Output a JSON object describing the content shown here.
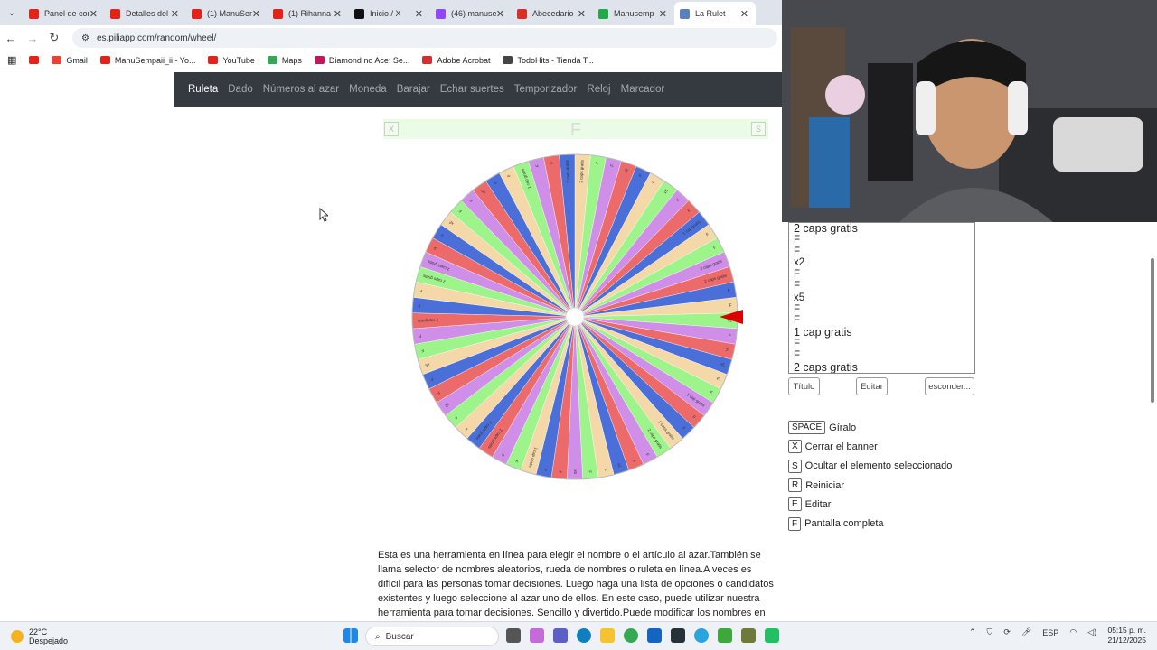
{
  "browser": {
    "tabs": [
      {
        "label": "Panel de con",
        "color": "#e62117"
      },
      {
        "label": "Detalles del",
        "color": "#e62117"
      },
      {
        "label": "(1) ManuSem",
        "color": "#e62117"
      },
      {
        "label": "(1) Rihanna",
        "color": "#e62117"
      },
      {
        "label": "Inicio / X",
        "color": "#111111"
      },
      {
        "label": "(46) manuse",
        "color": "#9146ff"
      },
      {
        "label": "Abecedario",
        "color": "#d93025"
      },
      {
        "label": "Manusemp",
        "color": "#22a84a"
      },
      {
        "label": "La Rulet",
        "color": "#5b7fbf"
      }
    ],
    "url": "es.piliapp.com/random/wheel/",
    "bookmarks": [
      {
        "label": "",
        "color": "#e62117"
      },
      {
        "label": "Gmail",
        "color": "#ea4335"
      },
      {
        "label": "ManuSempaii_ii - Yo...",
        "color": "#e62117"
      },
      {
        "label": "YouTube",
        "color": "#e62117"
      },
      {
        "label": "Maps",
        "color": "#34a853"
      },
      {
        "label": "Diamond no Ace: Se...",
        "color": "#c2185b"
      },
      {
        "label": "Adobe Acrobat",
        "color": "#d32f2f"
      },
      {
        "label": "TodoHits - Tienda T...",
        "color": "#444444"
      }
    ]
  },
  "site": {
    "nav": [
      "Ruleta",
      "Dado",
      "Números al azar",
      "Moneda",
      "Barajar",
      "Echar suertes",
      "Temporizador",
      "Reloj",
      "Marcador"
    ],
    "banner": {
      "close_key": "X",
      "title": "F",
      "save_key": "S"
    }
  },
  "wheel": {
    "colors": [
      "#f4d8a8",
      "#9df48a",
      "#cf8ee8",
      "#ec6a6a",
      "#4a6fd9"
    ],
    "labels": [
      "2 caps gratis",
      "F",
      "F",
      "x2",
      "F",
      "F",
      "x5",
      "F",
      "F",
      "1 cap gratis",
      "F",
      "F",
      "2 caps gratis"
    ],
    "pointer_color": "#dd0000"
  },
  "entries": [
    "2 caps gratis",
    "F",
    "F",
    "x2",
    "F",
    "F",
    "x5",
    "F",
    "F",
    "1 cap gratis",
    "F",
    "F",
    "2 caps gratis"
  ],
  "controls": {
    "title_btn": "Título",
    "edit_btn": "Editar",
    "hide_btn": "esconder..."
  },
  "shortcuts": [
    {
      "key": "SPACE",
      "label": "Gíralo"
    },
    {
      "key": "X",
      "label": "Cerrar el banner"
    },
    {
      "key": "S",
      "label": "Ocultar el elemento seleccionado"
    },
    {
      "key": "R",
      "label": "Reiniciar"
    },
    {
      "key": "E",
      "label": "Editar"
    },
    {
      "key": "F",
      "label": "Pantalla completa"
    }
  ],
  "description": "Esta es una herramienta en línea para elegir el nombre o el artículo al azar.También se llama selector de nombres aleatorios, rueda de nombres o ruleta en línea.A veces es difícil para las personas tomar decisiones. Luego haga una lista de opciones o candidatos existentes y luego seleccione al azar uno de ellos. En este caso, puede utilizar nuestra herramienta para tomar decisiones. Sencillo y divertido.Puede modificar los nombres en textarea, poner un",
  "taskbar": {
    "temp": "22°C",
    "weather": "Despejado",
    "search": "Buscar",
    "lang": "ESP",
    "time": "05:15 p. m.",
    "date": "21/12/2025"
  }
}
